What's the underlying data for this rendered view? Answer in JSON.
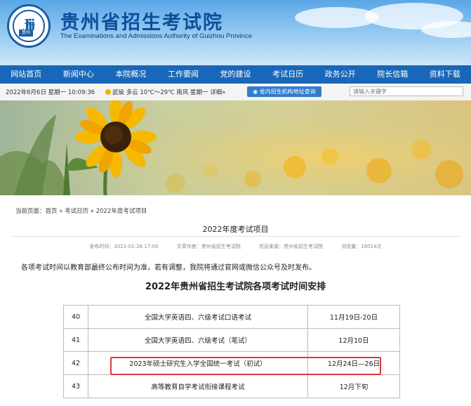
{
  "header": {
    "logo_mark": "Ɉɉɉ",
    "logo_text": "贵州",
    "title_cn": "贵州省招生考试院",
    "title_en": "The Examinations and Admissions Authority of Guizhou Province"
  },
  "nav": [
    "网站首页",
    "新闻中心",
    "本院概况",
    "工作要闻",
    "党的建设",
    "考试日历",
    "政务公开",
    "院长信箱",
    "资料下载"
  ],
  "infobar": {
    "datetime": "2022年6月6日 星期一 10:09:36",
    "weather": "武侯  多云 10℃～29℃  南风 星期一  详细»",
    "query_button": "◉ 省内招生机构地址查询",
    "search_placeholder": "请输入关键字"
  },
  "breadcrumb": "当前页面：首页 » 考试日历 » 2022年度考试项目",
  "article": {
    "title": "2022年度考试项目",
    "published": "发布时间：2022-01-26 17:00",
    "author": "文章作者：贵州省招生考试院",
    "source": "信息来源：贵州省招生考试院",
    "views": "浏览量：16014次",
    "notice": "各项考试时间以教育部最终公布时间为准，若有调整，我院将通过官网或微信公众号及时发布。",
    "heading": "2022年贵州省招生考试院各项考试时间安排"
  },
  "schedule": [
    {
      "no": "40",
      "name": "全国大学英语四、六级考试口语考试",
      "date": "11月19日-20日"
    },
    {
      "no": "41",
      "name": "全国大学英语四、六级考试（笔试）",
      "date": "12月10日"
    },
    {
      "no": "42",
      "name": "2023年硕士研究生入学全国统一考试（初试）",
      "date": "12月24日—26日"
    },
    {
      "no": "43",
      "name": "高等教育自学考试衔接课程考试",
      "date": "12月下旬"
    }
  ],
  "colors": {
    "nav_bg": "#1967b8",
    "highlight": "#e0393e",
    "title": "#0d4f9c"
  }
}
